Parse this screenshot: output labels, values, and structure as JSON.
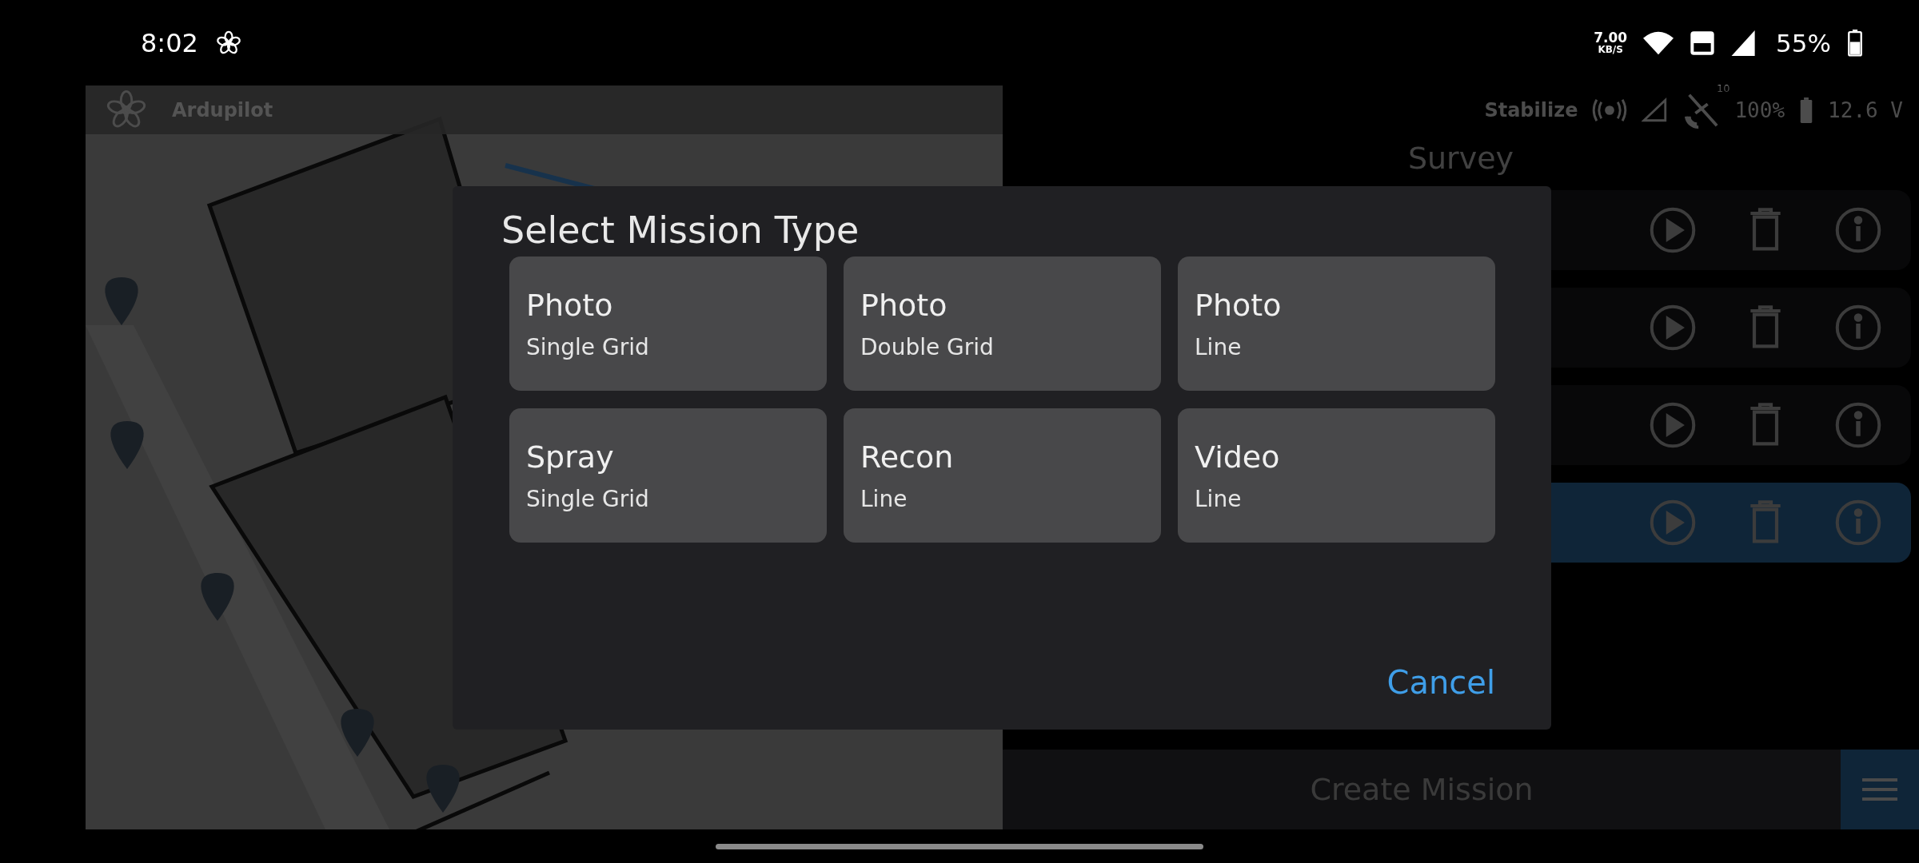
{
  "status_bar": {
    "time": "8:02",
    "speed_value": "7.00",
    "speed_unit": "KB/S",
    "battery": "55%"
  },
  "app_bar": {
    "title": "Ardupilot"
  },
  "telemetry": {
    "mode": "Stabilize",
    "satellites": "10",
    "battery": "100%",
    "voltage": "12.6 V"
  },
  "panel": {
    "title": "Survey",
    "missions": [
      {
        "selected": false
      },
      {
        "selected": false
      },
      {
        "selected": false
      },
      {
        "selected": true
      }
    ],
    "create_button": "Create Mission"
  },
  "dialog": {
    "title": "Select Mission Type",
    "options": [
      {
        "title": "Photo",
        "subtitle": "Single Grid"
      },
      {
        "title": "Photo",
        "subtitle": "Double Grid"
      },
      {
        "title": "Photo",
        "subtitle": "Line"
      },
      {
        "title": "Spray",
        "subtitle": "Single Grid"
      },
      {
        "title": "Recon",
        "subtitle": "Line"
      },
      {
        "title": "Video",
        "subtitle": "Line"
      }
    ],
    "cancel": "Cancel"
  }
}
